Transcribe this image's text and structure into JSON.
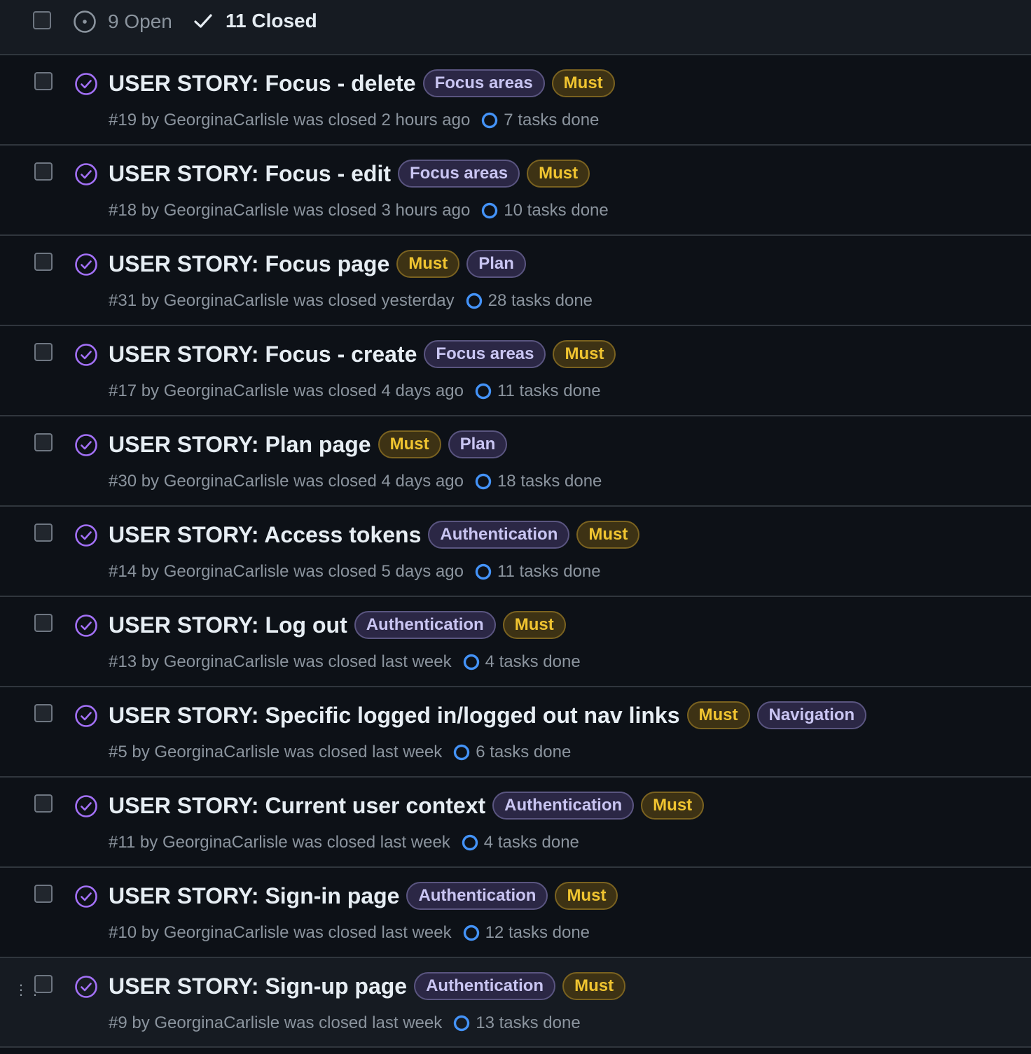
{
  "header": {
    "open_label": "9 Open",
    "closed_label": "11 Closed"
  },
  "colors": {
    "closed_icon": "#a371f7",
    "progress_ring": "#4493f8",
    "label_purple": "#c9c5f2",
    "label_gold": "#f0c430"
  },
  "issues": [
    {
      "title": "USER STORY: Focus - delete",
      "labels": [
        {
          "text": "Focus areas",
          "color": "purple"
        },
        {
          "text": "Must",
          "color": "gold"
        }
      ],
      "meta": "#19 by GeorginaCarlisle was closed 2 hours ago",
      "tasks": "7 tasks done"
    },
    {
      "title": "USER STORY: Focus - edit",
      "labels": [
        {
          "text": "Focus areas",
          "color": "purple"
        },
        {
          "text": "Must",
          "color": "gold"
        }
      ],
      "meta": "#18 by GeorginaCarlisle was closed 3 hours ago",
      "tasks": "10 tasks done"
    },
    {
      "title": "USER STORY: Focus page",
      "labels": [
        {
          "text": "Must",
          "color": "gold"
        },
        {
          "text": "Plan",
          "color": "purple"
        }
      ],
      "meta": "#31 by GeorginaCarlisle was closed yesterday",
      "tasks": "28 tasks done"
    },
    {
      "title": "USER STORY: Focus - create",
      "labels": [
        {
          "text": "Focus areas",
          "color": "purple"
        },
        {
          "text": "Must",
          "color": "gold"
        }
      ],
      "meta": "#17 by GeorginaCarlisle was closed 4 days ago",
      "tasks": "11 tasks done"
    },
    {
      "title": "USER STORY: Plan page",
      "labels": [
        {
          "text": "Must",
          "color": "gold"
        },
        {
          "text": "Plan",
          "color": "purple"
        }
      ],
      "meta": "#30 by GeorginaCarlisle was closed 4 days ago",
      "tasks": "18 tasks done"
    },
    {
      "title": "USER STORY: Access tokens",
      "labels": [
        {
          "text": "Authentication",
          "color": "purple"
        },
        {
          "text": "Must",
          "color": "gold"
        }
      ],
      "meta": "#14 by GeorginaCarlisle was closed 5 days ago",
      "tasks": "11 tasks done"
    },
    {
      "title": "USER STORY: Log out",
      "labels": [
        {
          "text": "Authentication",
          "color": "purple"
        },
        {
          "text": "Must",
          "color": "gold"
        }
      ],
      "meta": "#13 by GeorginaCarlisle was closed last week",
      "tasks": "4 tasks done"
    },
    {
      "title": "USER STORY: Specific logged in/logged out nav links",
      "labels": [
        {
          "text": "Must",
          "color": "gold"
        },
        {
          "text": "Navigation",
          "color": "purple"
        }
      ],
      "meta": "#5 by GeorginaCarlisle was closed last week",
      "tasks": "6 tasks done"
    },
    {
      "title": "USER STORY: Current user context",
      "labels": [
        {
          "text": "Authentication",
          "color": "purple"
        },
        {
          "text": "Must",
          "color": "gold"
        }
      ],
      "meta": "#11 by GeorginaCarlisle was closed last week",
      "tasks": "4 tasks done"
    },
    {
      "title": "USER STORY: Sign-in page",
      "labels": [
        {
          "text": "Authentication",
          "color": "purple"
        },
        {
          "text": "Must",
          "color": "gold"
        }
      ],
      "meta": "#10 by GeorginaCarlisle was closed last week",
      "tasks": "12 tasks done"
    },
    {
      "title": "USER STORY: Sign-up page",
      "labels": [
        {
          "text": "Authentication",
          "color": "purple"
        },
        {
          "text": "Must",
          "color": "gold"
        }
      ],
      "meta": "#9 by GeorginaCarlisle was closed last week",
      "tasks": "13 tasks done"
    }
  ]
}
